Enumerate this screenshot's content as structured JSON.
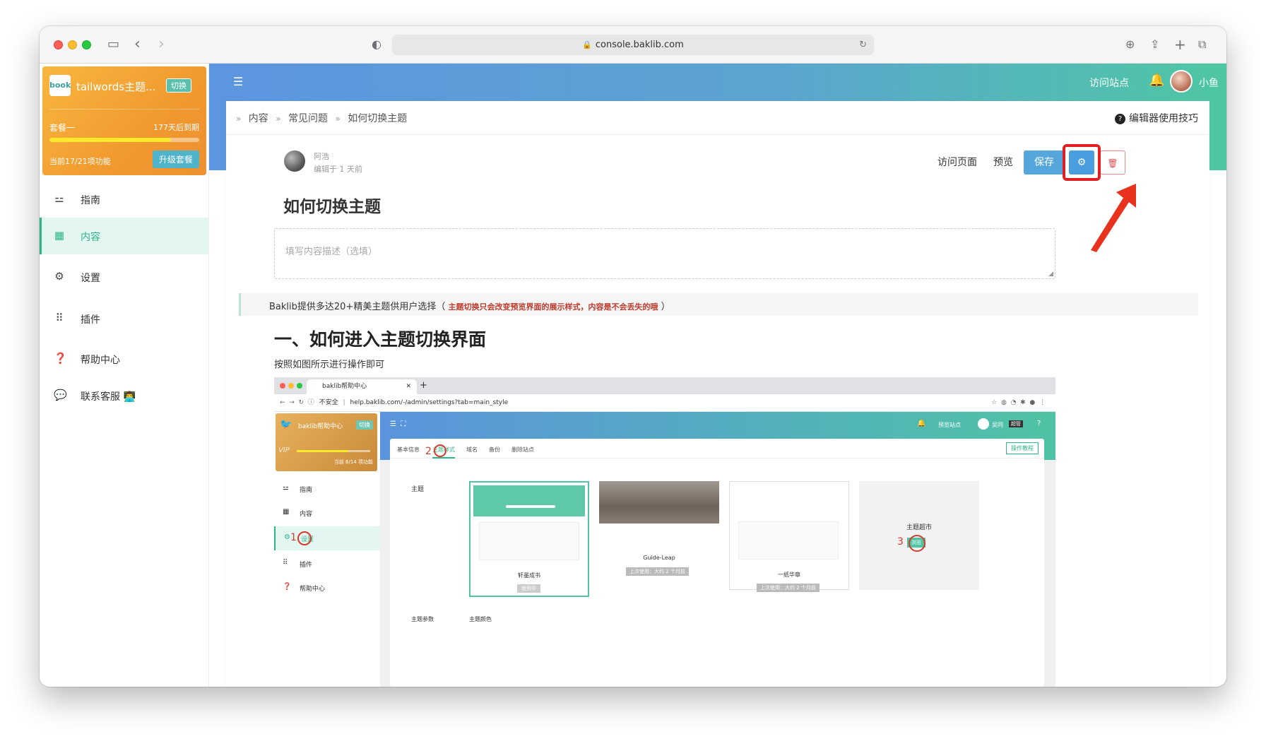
{
  "browser": {
    "url": "console.baklib.com"
  },
  "topbar": {
    "visit_site": "访问站点",
    "username": "小鱼"
  },
  "plan": {
    "title": "tailwords主题...",
    "switch": "切换",
    "name": "套餐一",
    "expires": "177天后到期",
    "features": "当前17/21项功能",
    "upgrade": "升级套餐",
    "progress": 0.81
  },
  "sidebar": {
    "items": [
      {
        "label": "指南",
        "icon": "signpost-icon"
      },
      {
        "label": "内容",
        "icon": "grid-icon"
      },
      {
        "label": "设置",
        "icon": "gear-icon"
      },
      {
        "label": "插件",
        "icon": "apps-icon"
      },
      {
        "label": "帮助中心",
        "icon": "help-icon"
      },
      {
        "label": "联系客服 👨‍💻",
        "icon": "chat-icon"
      }
    ]
  },
  "breadcrumb": [
    "内容",
    "常见问题",
    "如何切换主题"
  ],
  "editor_tips": "编辑器使用技巧",
  "article": {
    "author": "阿浩",
    "edited": "编辑于 1 天前",
    "title": "如何切换主题",
    "desc_placeholder": "填写内容描述（选填）",
    "quote_main": "Baklib提供多达20+精美主题供用户选择（ ",
    "quote_red": "主题切换只会改变预览界面的展示样式，内容是不会丢失的哦",
    "quote_end": " ）",
    "h1": "一、如何进入主题切换界面",
    "p1": "按照如图所示进行操作即可"
  },
  "toolbar": {
    "visit": "访问页面",
    "preview": "预览",
    "save": "保存"
  },
  "embedded": {
    "tab_title": "baklib帮助中心",
    "url_insecure": "不安全",
    "url": "help.baklib.com/-/admin/settings?tab=main_style",
    "plan_title": "baklib帮助中心",
    "plan_switch": "切换",
    "plan_features": "当前 6/14 项功能",
    "nav": [
      "指南",
      "内容",
      "设置",
      "插件",
      "帮助中心"
    ],
    "preview_site": "预览站点",
    "user": "吴同",
    "user_badge": "超管",
    "tabs": [
      "基本信息",
      "主题样式",
      "域名",
      "备份",
      "删除站点"
    ],
    "tutorial": "操作教程",
    "label_theme": "主题",
    "themes": [
      {
        "name": "轩墨成书",
        "status": "使用中"
      },
      {
        "name": "Guide-Leap",
        "status": "上次使用：大约 2 个月前"
      },
      {
        "name": "一纸华章",
        "status": "上次使用：大约 2 个月前"
      }
    ],
    "market": "主题超市",
    "browse": "浏览",
    "params": "主题参数",
    "color": "主题颜色",
    "steps": [
      "1",
      "2",
      "3"
    ]
  }
}
